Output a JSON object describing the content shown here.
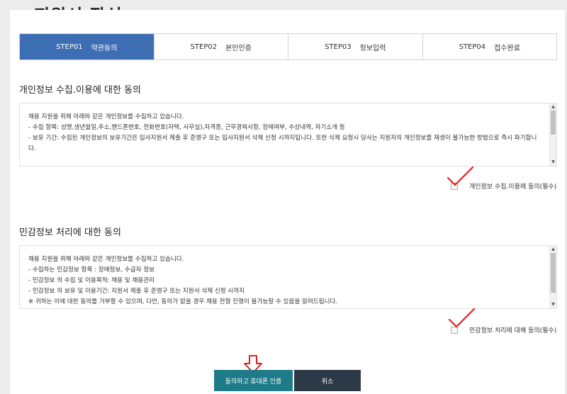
{
  "page": {
    "title": "지원서 작성"
  },
  "steps": [
    {
      "num": "STEP01",
      "label": "약관동의",
      "active": true
    },
    {
      "num": "STEP02",
      "label": "본인인증",
      "active": false
    },
    {
      "num": "STEP03",
      "label": "정보입력",
      "active": false
    },
    {
      "num": "STEP04",
      "label": "접수완료",
      "active": false
    }
  ],
  "privacy": {
    "title": "개인정보 수집.이용에 대한 동의",
    "lines": [
      "채용 지원을 위해 아래와 같은 개인정보를 수집하고 있습니다.",
      "- 수집 항목: 성명,생년월일,주소,핸드폰번호, 전화번호(자택, 사무실),자격증, 근무경력사항, 장애여부, 수상내역, 자기소개 등",
      "- 보유 기간: 수집된 개인정보의 보유기간은 입사지원서 제출 후 준영구 또는 입사지원서 삭제 신청 시까지입니다. 또한 삭제 요청시 당사는 지원자의 개인정보를 재생이 불가능한 방법으로 즉시 파기합니다."
    ],
    "consent_label": "개인정보 수집.이용에 동의(필수)"
  },
  "sensitive": {
    "title": "민감정보 처리에 대한 동의",
    "lines": [
      "채용 지원을 위해 아래와 같은 개인정보를 수집하고 있습니다.",
      "- 수집하는 민감정보 항목 : 장애정보, 수급자 정보",
      "- 민감정보 의 수집 및 이용목적: 채용 및 채용관리",
      "- 민감정보 의 보유 및 이용기간: 지원서 제출 후 준영구 또는 지원서 삭제 신청 시까지",
      "※ 귀하는 이에 대한 동의를 거부할 수 있으며, 다만, 동의가 없을 경우 채용 전형 진행이 불가능할 수 있음을 알려드립니다."
    ],
    "consent_label": "민감정보 처리에 대해 동의(필수)"
  },
  "buttons": {
    "agree": "동의하고 휴대폰 인증",
    "cancel": "취소"
  },
  "colors": {
    "step_active": "#3d6eb3",
    "agree_button": "#1e7c8a",
    "cancel_button": "#2c3947",
    "annotation": "#e02020"
  },
  "icons": {
    "check": "check-annotation-icon",
    "arrow": "down-arrow-annotation-icon"
  }
}
